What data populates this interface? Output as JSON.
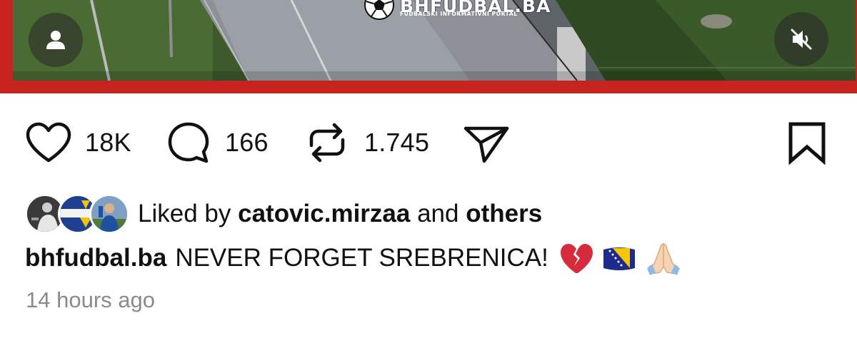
{
  "brand": {
    "logo_title": "BHFUDBAL.BA",
    "logo_subtitle": "FUDBALSKI INFORMATIVNI PORTAL"
  },
  "media": {
    "border_color": "#c8241f",
    "profile_icon": "person-icon",
    "mute_icon": "speaker-muted-icon"
  },
  "actions": {
    "likes_count": "18K",
    "comments_count": "166",
    "reposts_count": "1.745",
    "like_icon": "heart-icon",
    "comment_icon": "comment-bubble-icon",
    "repost_icon": "repost-icon",
    "share_icon": "paper-plane-icon",
    "save_icon": "bookmark-icon"
  },
  "likes": {
    "prefix": "Liked by",
    "user": "catovic.mirzaa",
    "connector": "and",
    "others": "others"
  },
  "caption": {
    "username": "bhfudbal.ba",
    "text": "NEVER FORGET SREBRENICA!",
    "emojis": [
      "broken-heart-icon",
      "bosnia-flag-icon",
      "folded-hands-icon"
    ]
  },
  "timestamp": "14 hours ago"
}
